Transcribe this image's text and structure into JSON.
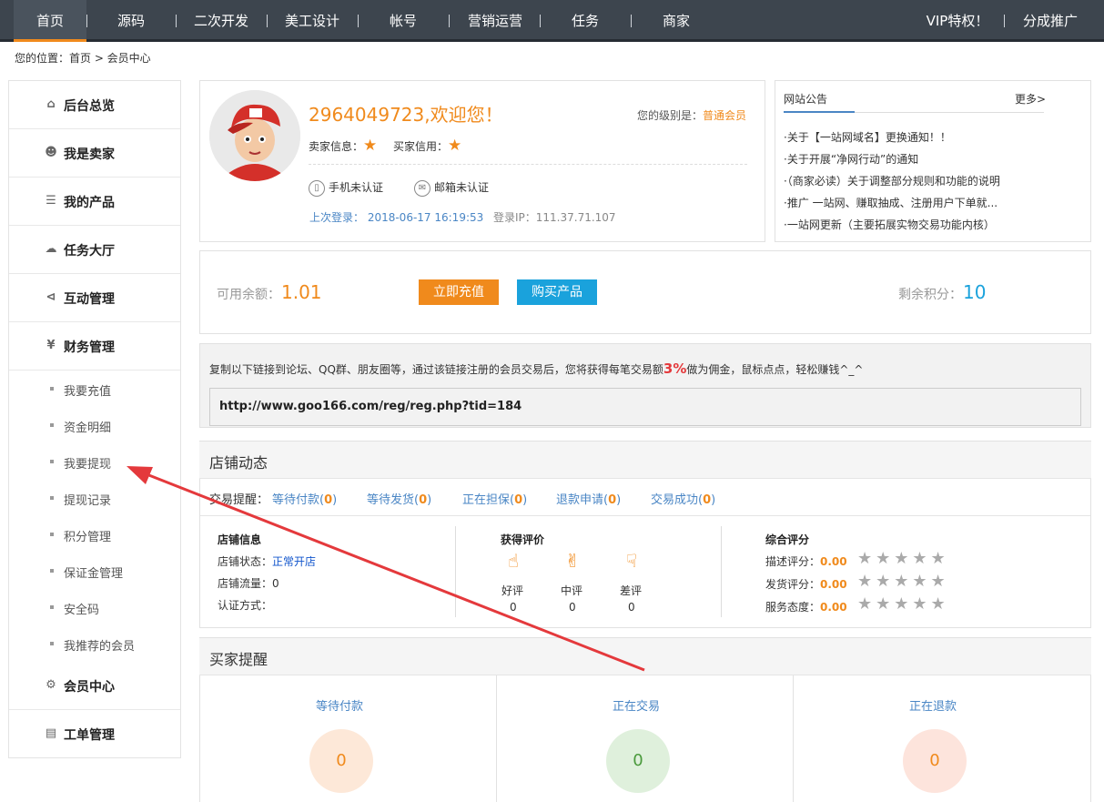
{
  "nav": {
    "items": [
      "首页",
      "源码",
      "二次开发",
      "美工设计",
      "帐号",
      "营销运营",
      "任务",
      "商家"
    ],
    "right": [
      "VIP特权！",
      "分成推广"
    ]
  },
  "breadcrumb": "您的位置：首页 > 会员中心",
  "sidebar": {
    "overview": "后台总览",
    "seller": "我是卖家",
    "products": "我的产品",
    "tasks": "任务大厅",
    "interaction": "互动管理",
    "finance": "财务管理",
    "finance_items": [
      "我要充值",
      "资金明细",
      "我要提现",
      "提现记录",
      "积分管理",
      "保证金管理",
      "安全码",
      "我推荐的会员"
    ],
    "member": "会员中心",
    "tickets": "工单管理"
  },
  "profile": {
    "welcome": "2964049723,欢迎您！",
    "level_label": "您的级别是：",
    "level_value": "普通会员",
    "seller_credit": "卖家信息：",
    "buyer_credit": "买家信用：",
    "phone": "手机未认证",
    "email": "邮箱未认证",
    "last_login": "上次登录： 2018-06-17 16:19:53",
    "login_ip": "登录IP：111.37.71.107"
  },
  "notice": {
    "title": "网站公告",
    "more": "更多>",
    "items": [
      "·关于【一站网域名】更换通知！！",
      "·关于开展“净网行动”的通知",
      "·（商家必读）关于调整部分规则和功能的说明",
      "·推广 一站网、赚取抽成、注册用户下单就...",
      "·一站网更新（主要拓展实物交易功能内核）"
    ]
  },
  "balance": {
    "label": "可用余额：",
    "value": "1.01",
    "charge_btn": "立即充值",
    "buy_btn": "购买产品",
    "points_label": "剩余积分：",
    "points_value": "10"
  },
  "promo": {
    "text_before": "复制以下链接到论坛、QQ群、朋友圈等，通过该链接注册的会员交易后，您将获得每笔交易额",
    "percent": "3%",
    "text_after": "做为佣金，鼠标点点，轻松赚钱^_^",
    "link": "http://www.goo166.com/reg/reg.php?tid=184"
  },
  "store": {
    "title": "店铺动态",
    "trade_label": "交易提醒：",
    "trades": [
      {
        "label": "等待付款",
        "count": "0"
      },
      {
        "label": "等待发货",
        "count": "0"
      },
      {
        "label": "正在担保",
        "count": "0"
      },
      {
        "label": "退款申请",
        "count": "0"
      },
      {
        "label": "交易成功",
        "count": "0"
      }
    ],
    "info_title": "店铺信息",
    "status_label": "店铺状态：",
    "status_value": "正常开店",
    "traffic": "店铺流量：0",
    "verify": "认证方式：",
    "eval_title": "获得评价",
    "evals": [
      {
        "label": "好评",
        "count": "0"
      },
      {
        "label": "中评",
        "count": "0"
      },
      {
        "label": "差评",
        "count": "0"
      }
    ],
    "score_title": "综合评分",
    "scores": [
      {
        "label": "描述评分：",
        "value": "0.00"
      },
      {
        "label": "发货评分：",
        "value": "0.00"
      },
      {
        "label": "服务态度：",
        "value": "0.00"
      }
    ]
  },
  "buyer": {
    "title": "买家提醒",
    "cols": [
      {
        "label": "等待付款",
        "count": "0"
      },
      {
        "label": "正在交易",
        "count": "0"
      },
      {
        "label": "正在退款",
        "count": "0"
      }
    ]
  },
  "colors": {
    "accent": "#f08a1c",
    "blue": "#1aa2dc",
    "link": "#4a86c5",
    "nav_bg": "#3d454e",
    "arrow": "#e4393c"
  }
}
